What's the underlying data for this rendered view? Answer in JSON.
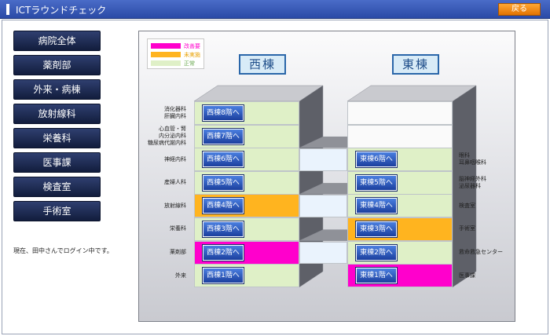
{
  "window": {
    "title": "ICTラウンドチェック",
    "back_label": "戻る"
  },
  "sidebar": {
    "items": [
      "病院全体",
      "薬剤部",
      "外来・病棟",
      "放射線科",
      "栄養科",
      "医事課",
      "検査室",
      "手術室"
    ]
  },
  "login_status": "現在、田中さんでログイン中です。",
  "legend": [
    {
      "label": "改善要",
      "color": "#ff00cc",
      "text_color": "#ff00cc"
    },
    {
      "label": "未実施",
      "color": "#ffb41f",
      "text_color": "#e8a000"
    },
    {
      "label": "正常",
      "color": "#dff0c7",
      "text_color": "#6aa84f"
    }
  ],
  "west": {
    "title": "西棟",
    "floors": [
      {
        "button": "西棟8階へ",
        "dept": "消化器科\n肝臓内科",
        "status": "normal"
      },
      {
        "button": "西棟7階へ",
        "dept": "心血管・腎\n内分泌内科\n糖尿病代謝内科",
        "status": "normal"
      },
      {
        "button": "西棟6階へ",
        "dept": "神経内科",
        "status": "normal"
      },
      {
        "button": "西棟5階へ",
        "dept": "産婦人科",
        "status": "normal"
      },
      {
        "button": "西棟4階へ",
        "dept": "放射線科",
        "status": "pending"
      },
      {
        "button": "西棟3階へ",
        "dept": "栄養科",
        "status": "normal"
      },
      {
        "button": "西棟2階へ",
        "dept": "薬剤部",
        "status": "improve"
      },
      {
        "button": "西棟1階へ",
        "dept": "外来",
        "status": "normal"
      }
    ]
  },
  "east": {
    "title": "東棟",
    "floors": [
      {
        "button": "",
        "dept": "",
        "status": "empty"
      },
      {
        "button": "",
        "dept": "",
        "status": "empty"
      },
      {
        "button": "東棟6階へ",
        "dept": "眼科\n耳鼻咽喉科",
        "status": "normal"
      },
      {
        "button": "東棟5階へ",
        "dept": "脳神経外科\n泌尿器科",
        "status": "normal"
      },
      {
        "button": "東棟4階へ",
        "dept": "検査室",
        "status": "normal"
      },
      {
        "button": "東棟3階へ",
        "dept": "手術室",
        "status": "pending"
      },
      {
        "button": "東棟2階へ",
        "dept": "救命救急センター",
        "status": "normal"
      },
      {
        "button": "東棟1階へ",
        "dept": "医事課",
        "status": "improve"
      }
    ]
  },
  "colors": {
    "improve": "#ff00cc",
    "pending": "#ffb41f",
    "normal": "#dff0c7",
    "empty": "#fafafa",
    "bridge": "#eaf3fd"
  }
}
